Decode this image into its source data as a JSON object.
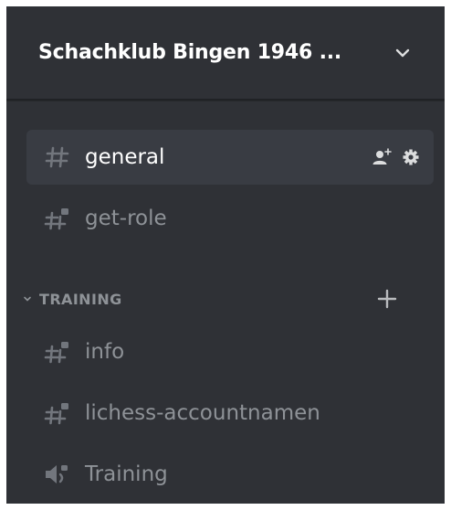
{
  "server": {
    "name": "Schachklub Bingen 1946 ..."
  },
  "channels": [
    {
      "name": "general",
      "type": "text",
      "selected": true
    },
    {
      "name": "get-role",
      "type": "rules-text"
    }
  ],
  "category": {
    "label": "TRAINING",
    "channels": [
      {
        "name": "info",
        "type": "rules-text"
      },
      {
        "name": "lichess-accountnamen",
        "type": "rules-text"
      },
      {
        "name": "Training",
        "type": "voice"
      }
    ]
  },
  "icons": {
    "header_chevron": "chevron-down-icon",
    "text_channel": "hash-icon",
    "rules_channel": "hash-locked-icon",
    "voice_channel": "speaker-icon",
    "invite": "add-member-icon",
    "settings": "gear-icon",
    "category_collapse": "chevron-down-icon",
    "create_channel": "plus-icon"
  },
  "colors": {
    "sidebar_bg": "#2f3136",
    "selected_bg": "#393c43",
    "text_active": "#ffffff",
    "text_muted": "#8e9297",
    "icon_muted": "#72767d"
  }
}
